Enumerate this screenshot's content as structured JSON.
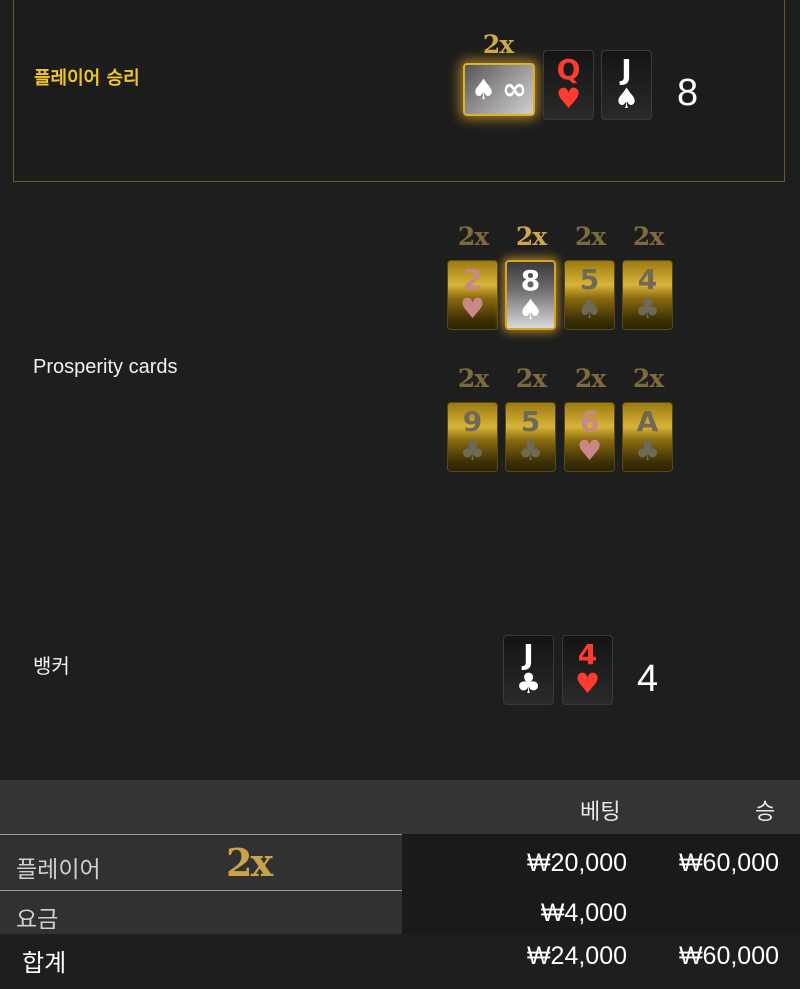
{
  "player": {
    "label": "플레이어 승리",
    "bonus_multiplier": "2x",
    "bonus_card_suit": "♠",
    "bonus_card_symbol": "∞",
    "cards": [
      {
        "rank": "Q",
        "suit": "♥",
        "color": "red"
      },
      {
        "rank": "J",
        "suit": "♠",
        "color": "white"
      }
    ],
    "score": "8"
  },
  "prosperity": {
    "label": "Prosperity cards",
    "row1": [
      {
        "mult": "2x",
        "rank": "2",
        "suit": "♥",
        "style": "gold-red",
        "highlight": false
      },
      {
        "mult": "2x",
        "rank": "8",
        "suit": "♠",
        "style": "silver",
        "highlight": true
      },
      {
        "mult": "2x",
        "rank": "5",
        "suit": "♠",
        "style": "gold",
        "highlight": false
      },
      {
        "mult": "2x",
        "rank": "4",
        "suit": "♣",
        "style": "gold",
        "highlight": false
      }
    ],
    "row2": [
      {
        "mult": "2x",
        "rank": "9",
        "suit": "♣",
        "style": "gold",
        "highlight": false
      },
      {
        "mult": "2x",
        "rank": "5",
        "suit": "♣",
        "style": "gold",
        "highlight": false
      },
      {
        "mult": "2x",
        "rank": "6",
        "suit": "♥",
        "style": "gold-red",
        "highlight": false
      },
      {
        "mult": "2x",
        "rank": "A",
        "suit": "♣",
        "style": "gold",
        "highlight": false
      }
    ]
  },
  "banker": {
    "label": "뱅커",
    "cards": [
      {
        "rank": "J",
        "suit": "♣",
        "color": "white"
      },
      {
        "rank": "4",
        "suit": "♥",
        "color": "red"
      }
    ],
    "score": "4"
  },
  "summary": {
    "header_bet": "베팅",
    "header_win": "승",
    "rows": [
      {
        "label": "플레이어",
        "multiplier": "2x",
        "bet": "₩20,000",
        "win": "₩60,000"
      },
      {
        "label": "요금",
        "multiplier": "",
        "bet": "₩4,000",
        "win": ""
      },
      {
        "label": "합계",
        "multiplier": "",
        "bet": "₩24,000",
        "win": "₩60,000"
      }
    ]
  },
  "colors": {
    "accent_gold": "#f0c52b",
    "multiplier_gold": "#cfa749",
    "card_red": "#ff3b30"
  }
}
